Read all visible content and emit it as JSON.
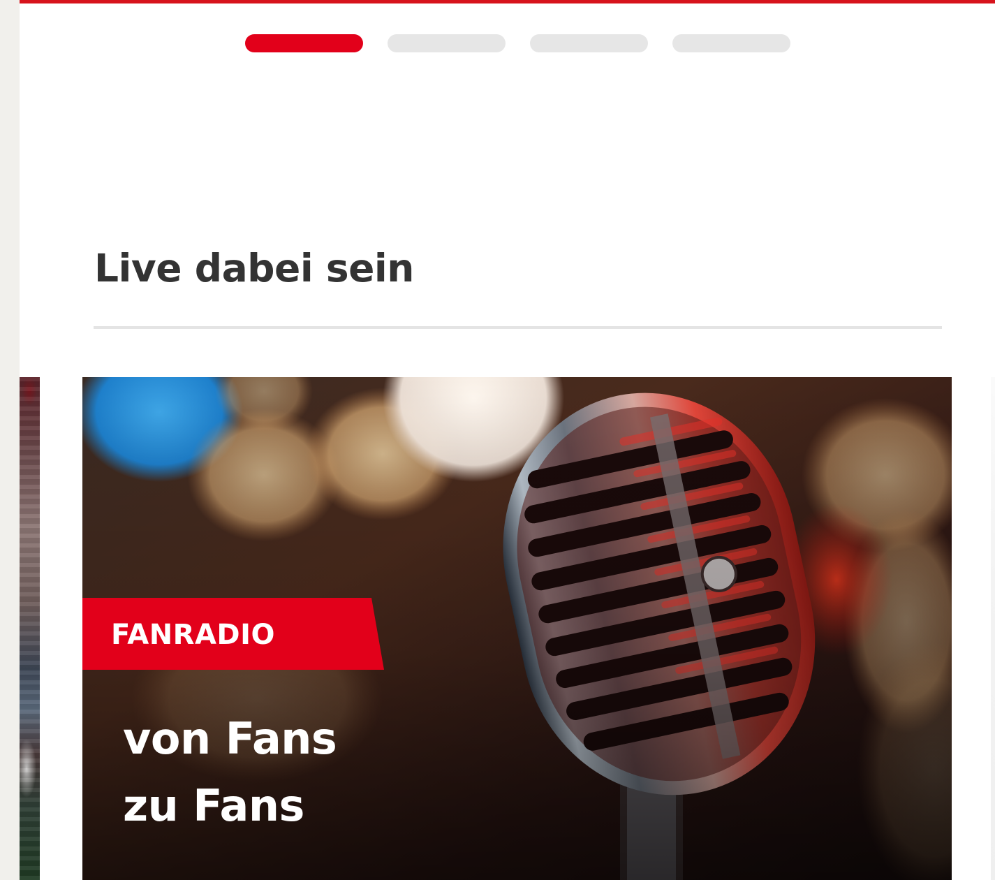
{
  "pager": {
    "active_index": 0,
    "count": 4,
    "accent_color": "#e2001a"
  },
  "section": {
    "title": "Live dabei sein"
  },
  "card": {
    "badge": "FANRADIO",
    "headline_line1": "von Fans",
    "headline_line2": "zu Fans",
    "image": "microphone-photo"
  },
  "colors": {
    "brand_red": "#e2001a",
    "title_text": "#333333",
    "divider": "#e4e4e4"
  }
}
